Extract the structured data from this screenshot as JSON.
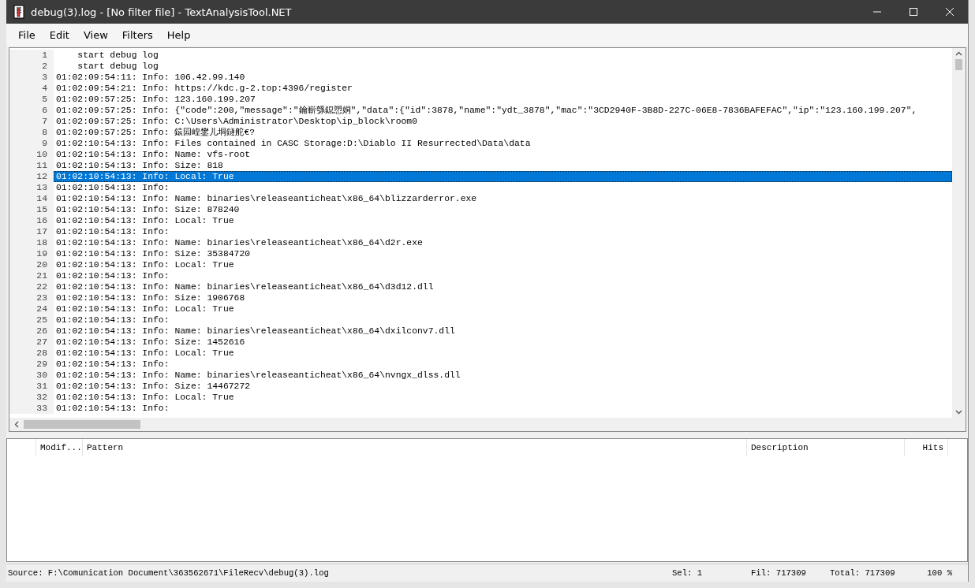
{
  "window": {
    "title": "debug(3).log - [No filter file] - TextAnalysisTool.NET"
  },
  "menu": [
    "File",
    "Edit",
    "View",
    "Filters",
    "Help"
  ],
  "lines": [
    {
      "number": "1",
      "text": "    start debug log",
      "selected": false
    },
    {
      "number": "2",
      "text": "    start debug log",
      "selected": false
    },
    {
      "number": "3",
      "text": "01:02:09:54:11: Info: 106.42.99.140",
      "selected": false
    },
    {
      "number": "4",
      "text": "01:02:09:54:21: Info: https://kdc.g-2.top:4396/register",
      "selected": false
    },
    {
      "number": "5",
      "text": "01:02:09:57:25: Info: 123.160.199.207",
      "selected": false
    },
    {
      "number": "6",
      "text": "01:02:09:57:25: Info: {\"code\":200,\"message\":\"鑰嶄綔鎴愬姛\",\"data\":{\"id\":3878,\"name\":\"ydt_3878\",\"mac\":\"3CD2940F-3B8D-227C-06E8-7836BAFEFAC\",\"ip\":\"123.160.199.207\",",
      "selected": false
    },
    {
      "number": "7",
      "text": "01:02:09:57:25: Info: C:\\Users\\Administrator\\Desktop\\ip_block\\room0",
      "selected": false
    },
    {
      "number": "8",
      "text": "01:02:09:57:25: Info: 鎱囩崲鐢儿垌鐩舵€?",
      "selected": false
    },
    {
      "number": "9",
      "text": "01:02:10:54:13: Info: Files contained in CASC Storage:D:\\Diablo II Resurrected\\Data\\data",
      "selected": false
    },
    {
      "number": "10",
      "text": "01:02:10:54:13: Info: Name: vfs-root",
      "selected": false
    },
    {
      "number": "11",
      "text": "01:02:10:54:13: Info: Size: 818",
      "selected": false
    },
    {
      "number": "12",
      "text": "01:02:10:54:13: Info: Local: True",
      "selected": true
    },
    {
      "number": "13",
      "text": "01:02:10:54:13: Info:",
      "selected": false
    },
    {
      "number": "14",
      "text": "01:02:10:54:13: Info: Name: binaries\\releaseanticheat\\x86_64\\blizzarderror.exe",
      "selected": false
    },
    {
      "number": "15",
      "text": "01:02:10:54:13: Info: Size: 878240",
      "selected": false
    },
    {
      "number": "16",
      "text": "01:02:10:54:13: Info: Local: True",
      "selected": false
    },
    {
      "number": "17",
      "text": "01:02:10:54:13: Info:",
      "selected": false
    },
    {
      "number": "18",
      "text": "01:02:10:54:13: Info: Name: binaries\\releaseanticheat\\x86_64\\d2r.exe",
      "selected": false
    },
    {
      "number": "19",
      "text": "01:02:10:54:13: Info: Size: 35384720",
      "selected": false
    },
    {
      "number": "20",
      "text": "01:02:10:54:13: Info: Local: True",
      "selected": false
    },
    {
      "number": "21",
      "text": "01:02:10:54:13: Info:",
      "selected": false
    },
    {
      "number": "22",
      "text": "01:02:10:54:13: Info: Name: binaries\\releaseanticheat\\x86_64\\d3d12.dll",
      "selected": false
    },
    {
      "number": "23",
      "text": "01:02:10:54:13: Info: Size: 1906768",
      "selected": false
    },
    {
      "number": "24",
      "text": "01:02:10:54:13: Info: Local: True",
      "selected": false
    },
    {
      "number": "25",
      "text": "01:02:10:54:13: Info:",
      "selected": false
    },
    {
      "number": "26",
      "text": "01:02:10:54:13: Info: Name: binaries\\releaseanticheat\\x86_64\\dxilconv7.dll",
      "selected": false
    },
    {
      "number": "27",
      "text": "01:02:10:54:13: Info: Size: 1452616",
      "selected": false
    },
    {
      "number": "28",
      "text": "01:02:10:54:13: Info: Local: True",
      "selected": false
    },
    {
      "number": "29",
      "text": "01:02:10:54:13: Info:",
      "selected": false
    },
    {
      "number": "30",
      "text": "01:02:10:54:13: Info: Name: binaries\\releaseanticheat\\x86_64\\nvngx_dlss.dll",
      "selected": false
    },
    {
      "number": "31",
      "text": "01:02:10:54:13: Info: Size: 14467272",
      "selected": false
    },
    {
      "number": "32",
      "text": "01:02:10:54:13: Info: Local: True",
      "selected": false
    },
    {
      "number": "33",
      "text": "01:02:10:54:13: Info:",
      "selected": false
    }
  ],
  "filter_table": {
    "columns": [
      "Modif...",
      "Pattern",
      "Description",
      "Hits"
    ]
  },
  "status_bar": {
    "source": "Source: F:\\Comunication Document\\363562671\\FileRecv\\debug(3).log",
    "selected": "Sel: 1",
    "filtered": "Fil: 717309",
    "total": "Total: 717309",
    "zoom": "100 %"
  }
}
